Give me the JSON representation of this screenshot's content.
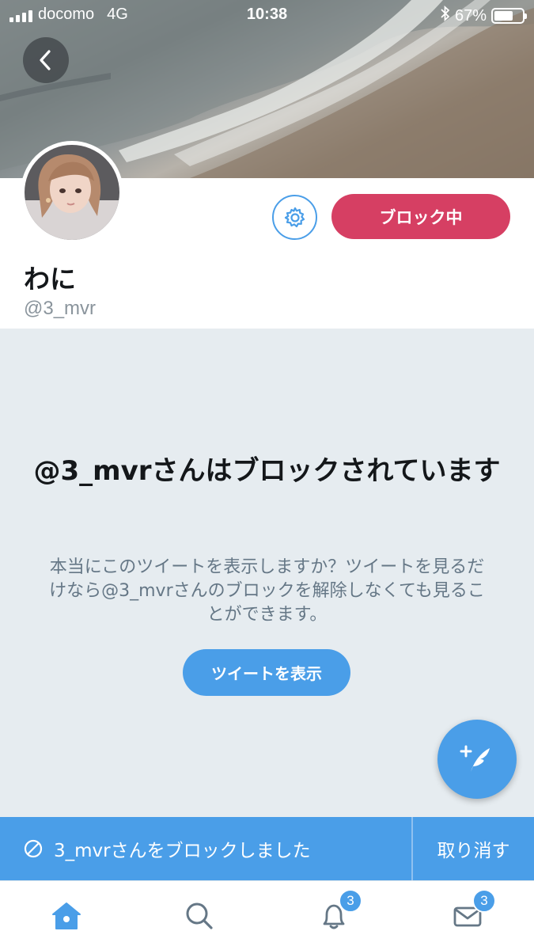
{
  "status_bar": {
    "carrier": "docomo",
    "network": "4G",
    "time": "10:38",
    "battery": "67%",
    "battery_level": 0.67
  },
  "profile": {
    "display_name": "わに",
    "handle": "@3_mvr",
    "blocked_button_label": "ブロック中"
  },
  "blocked_notice": {
    "title": "@3_mvrさんはブロックされています",
    "description": "本当にこのツイートを表示しますか？ツイートを見るだけなら@3_mvrさんのブロックを解除しなくても見ることができます。",
    "view_tweets_label": "ツイートを表示"
  },
  "snackbar": {
    "message": "3_mvrさんをブロックしました",
    "undo_label": "取り消す"
  },
  "tabbar": {
    "notifications_badge": "3",
    "messages_badge": "3"
  },
  "colors": {
    "accent": "#4a9ee8",
    "blocked": "#d63f63",
    "background_gray": "#e6ecf0"
  }
}
